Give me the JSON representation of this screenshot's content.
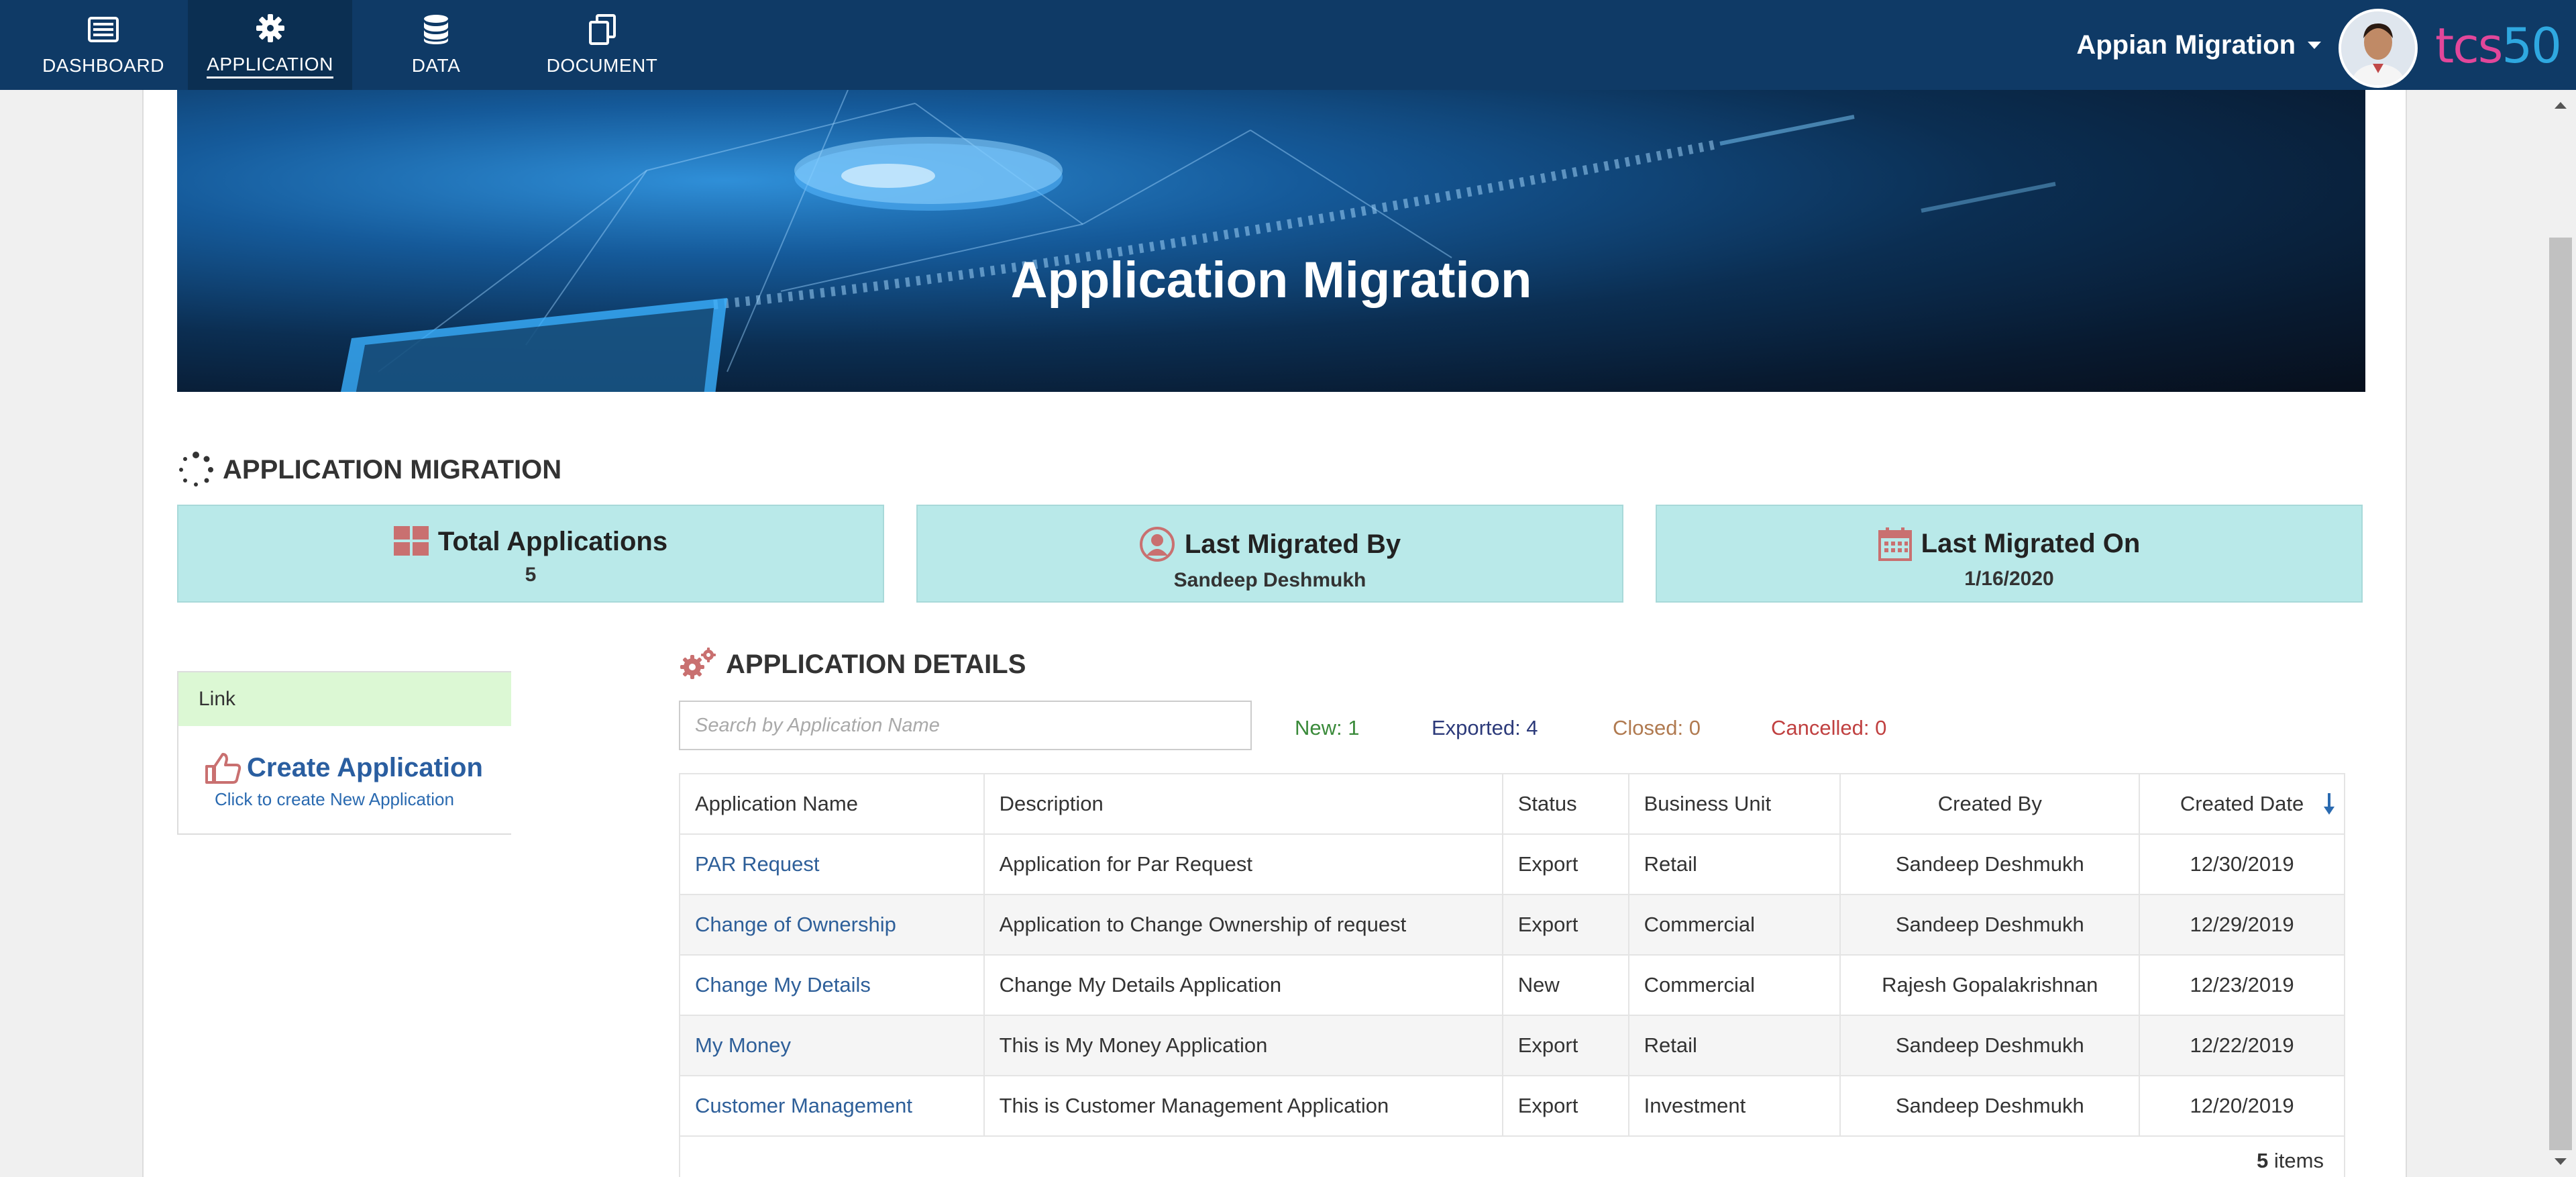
{
  "nav": {
    "items": [
      {
        "label": "DASHBOARD",
        "icon": "dashboard-icon"
      },
      {
        "label": "APPLICATION",
        "icon": "gear-icon"
      },
      {
        "label": "DATA",
        "icon": "database-icon"
      },
      {
        "label": "DOCUMENT",
        "icon": "document-copy-icon"
      }
    ],
    "active": "APPLICATION",
    "user_menu": "Appian Migration",
    "logo_part1": "tcs",
    "logo_part2": "50"
  },
  "banner": {
    "title": "Application Migration"
  },
  "summary": {
    "heading": "APPLICATION MIGRATION",
    "cards": [
      {
        "title": "Total Applications",
        "value": "5",
        "icon": "grid-icon"
      },
      {
        "title": "Last Migrated By",
        "value": "Sandeep Deshmukh",
        "icon": "user-circle-icon"
      },
      {
        "title": "Last Migrated On",
        "value": "1/16/2020",
        "icon": "calendar-icon"
      }
    ]
  },
  "links": {
    "header": "Link",
    "create_label": "Create Application",
    "create_sub": "Click to create New Application"
  },
  "details": {
    "heading": "APPLICATION DETAILS",
    "search_placeholder": "Search by Application Name",
    "stats": {
      "new": "New: 1",
      "exported": "Exported: 4",
      "closed": "Closed: 0",
      "cancelled": "Cancelled: 0"
    },
    "columns": [
      "Application Name",
      "Description",
      "Status",
      "Business Unit",
      "Created By",
      "Created Date"
    ],
    "rows": [
      [
        "PAR Request",
        "Application for Par Request",
        "Export",
        "Retail",
        "Sandeep Deshmukh",
        "12/30/2019"
      ],
      [
        "Change of Ownership",
        "Application to Change Ownership of request",
        "Export",
        "Commercial",
        "Sandeep Deshmukh",
        "12/29/2019"
      ],
      [
        "Change My Details",
        "Change My Details Application",
        "New",
        "Commercial",
        "Rajesh Gopalakrishnan",
        "12/23/2019"
      ],
      [
        "My Money",
        "This is My Money Application",
        "Export",
        "Retail",
        "Sandeep Deshmukh",
        "12/22/2019"
      ],
      [
        "Customer Management",
        "This is Customer Management Application",
        "Export",
        "Investment",
        "Sandeep Deshmukh",
        "12/20/2019"
      ]
    ],
    "item_count": "5",
    "item_label": "items"
  },
  "colors": {
    "navbar": "#0f3a66",
    "card_bg": "#b9e9e9",
    "link_header_bg": "#dcf8d4",
    "new": "#3a8a3a",
    "exported": "#2c3a7a",
    "closed": "#b07a50",
    "cancelled": "#c04040",
    "link_text": "#2e5f99"
  }
}
